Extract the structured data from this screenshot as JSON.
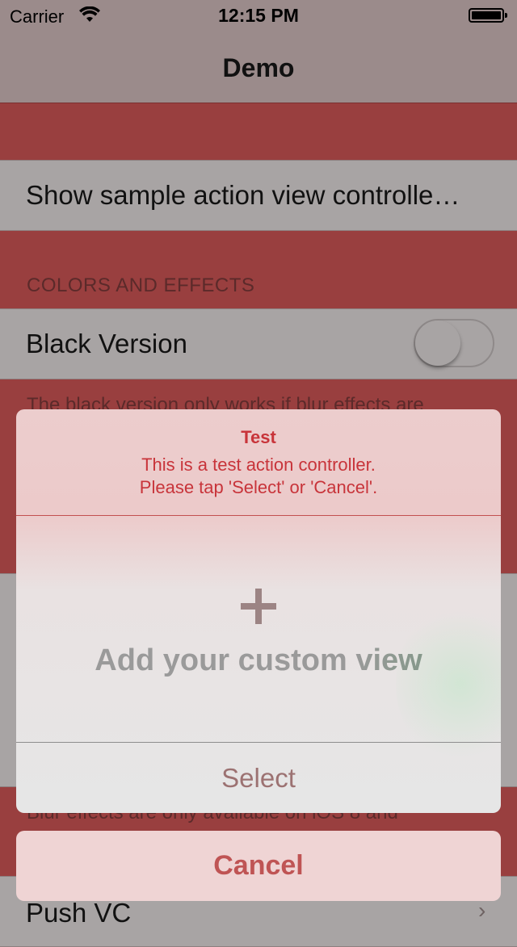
{
  "status_bar": {
    "carrier": "Carrier",
    "time": "12:15 PM"
  },
  "nav": {
    "title": "Demo"
  },
  "table": {
    "show_sample_label": "Show sample action view controlle…",
    "section_colors_header": "COLORS AND EFFECTS",
    "black_version_label": "Black Version",
    "black_version_footer": "The black version only works if blur effects are",
    "blur_footer": "Blur effects are only available on iOS 8 and",
    "push_vc_label": "Push VC"
  },
  "sheet": {
    "title": "Test",
    "message_line1": "This is a test action controller.",
    "message_line2": "Please tap 'Select' or 'Cancel'.",
    "custom_view_text": "Add your custom view",
    "select_label": "Select",
    "cancel_label": "Cancel"
  },
  "colors": {
    "background_red": "#993f3f",
    "accent_red": "#c8343a",
    "cancel_text": "#bf5454"
  }
}
